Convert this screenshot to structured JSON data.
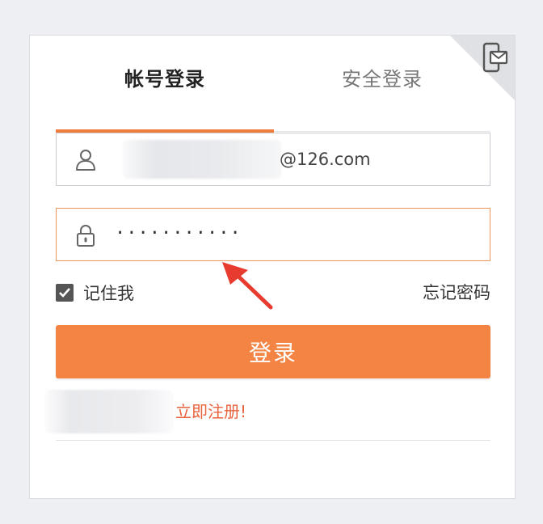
{
  "tabs": [
    {
      "label": "帐号登录",
      "active": true
    },
    {
      "label": "安全登录",
      "active": false
    }
  ],
  "username": {
    "suffix": "@126.com",
    "icon": "user-icon"
  },
  "password": {
    "masked_value": "···········",
    "icon": "lock-icon"
  },
  "remember": {
    "label": "记住我",
    "checked": true
  },
  "forgot_label": "忘记密码",
  "login_label": "登录",
  "register_label": "立即注册!",
  "colors": {
    "accent": "#f38443",
    "register": "#e8623c",
    "arrow": "#e63b2e"
  }
}
